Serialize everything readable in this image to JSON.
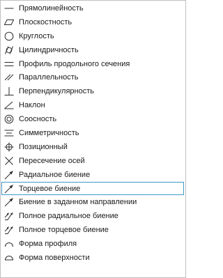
{
  "dropdown": {
    "items": [
      {
        "label": "Прямолинейность",
        "icon": "straightness-icon"
      },
      {
        "label": "Плоскостность",
        "icon": "flatness-icon"
      },
      {
        "label": "Круглость",
        "icon": "circularity-icon"
      },
      {
        "label": "Цилиндричность",
        "icon": "cylindricity-icon"
      },
      {
        "label": "Профиль продольного сечения",
        "icon": "longitudinal-profile-icon"
      },
      {
        "label": "Параллельность",
        "icon": "parallelism-icon"
      },
      {
        "label": "Перпендикулярность",
        "icon": "perpendicularity-icon"
      },
      {
        "label": "Наклон",
        "icon": "angularity-icon"
      },
      {
        "label": "Соосность",
        "icon": "concentricity-icon"
      },
      {
        "label": "Симметричность",
        "icon": "symmetry-icon"
      },
      {
        "label": "Позиционный",
        "icon": "position-icon"
      },
      {
        "label": "Пересечение осей",
        "icon": "axes-intersection-icon"
      },
      {
        "label": "Радиальное биение",
        "icon": "radial-runout-icon"
      },
      {
        "label": "Торцевое биение",
        "icon": "axial-runout-icon"
      },
      {
        "label": "Биение в заданном направлении",
        "icon": "directional-runout-icon"
      },
      {
        "label": "Полное радиальное биение",
        "icon": "total-radial-runout-icon"
      },
      {
        "label": "Полное торцевое биение",
        "icon": "total-axial-runout-icon"
      },
      {
        "label": "Форма профиля",
        "icon": "profile-of-line-icon"
      },
      {
        "label": "Форма поверхности",
        "icon": "profile-of-surface-icon"
      }
    ],
    "selected_index": 13,
    "colors": {
      "border": "#bfbfbf",
      "selection_border": "#3d99c6",
      "text": "#1a1a1a",
      "icon": "#2b2b2b"
    }
  }
}
